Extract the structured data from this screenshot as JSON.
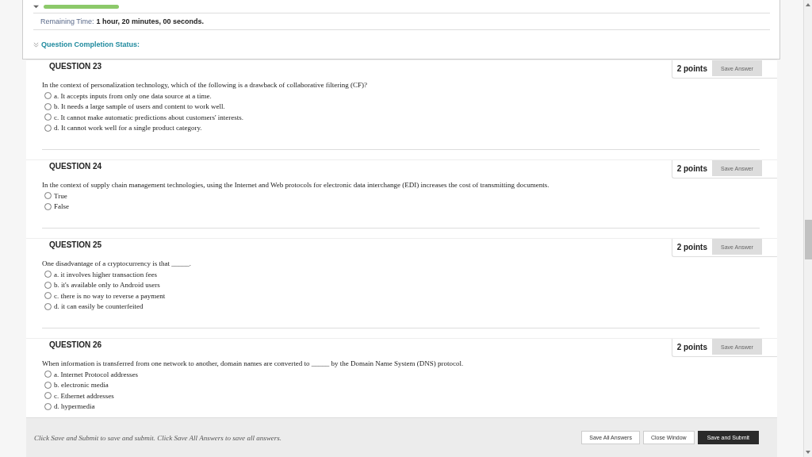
{
  "timer": {
    "level": 0.11,
    "label": "Remaining Time:",
    "value": "1 hour, 20 minutes, 00 seconds."
  },
  "completion_status": {
    "label": "Question Completion Status:",
    "expanded": false
  },
  "questions": [
    {
      "title": "QUESTION 23",
      "points": "2 points",
      "save_label": "Save Answer",
      "prompt": "In the context of personalization technology, which of the following is a drawback of collaborative filtering (CF)?",
      "options": [
        {
          "label": "a. It accepts inputs from only one data source at a time.",
          "selected": false
        },
        {
          "label": "b. It needs a large sample of users and content to work well.",
          "selected": false
        },
        {
          "label": "c. It cannot make automatic predictions about customers' interests.",
          "selected": false
        },
        {
          "label": "d. It cannot work well for a single product category.",
          "selected": false
        }
      ]
    },
    {
      "title": "QUESTION 24",
      "points": "2 points",
      "save_label": "Save Answer",
      "prompt": "In the context of supply chain management technologies, using the Internet and Web protocols for electronic data interchange (EDI) increases the cost of transmitting documents.",
      "options": [
        {
          "label": "True",
          "selected": false
        },
        {
          "label": "False",
          "selected": false
        }
      ]
    },
    {
      "title": "QUESTION 25",
      "points": "2 points",
      "save_label": "Save Answer",
      "prompt": "One disadvantage of a cryptocurrency is that _____.",
      "options": [
        {
          "label": "a. it involves higher transaction fees",
          "selected": false
        },
        {
          "label": "b. it's available only to Android users",
          "selected": false
        },
        {
          "label": "c. there is no way to reverse a payment",
          "selected": false
        },
        {
          "label": "d. it can easily be counterfeited",
          "selected": false
        }
      ]
    },
    {
      "title": "QUESTION 26",
      "points": "2 points",
      "save_label": "Save Answer",
      "prompt": "When information is transferred from one network to another, domain names are converted to _____ by the Domain Name System (DNS) protocol.",
      "options": [
        {
          "label": "a. Internet Protocol addresses",
          "selected": false
        },
        {
          "label": "b. electronic media",
          "selected": false
        },
        {
          "label": "c. Ethernet addresses",
          "selected": false
        },
        {
          "label": "d. hypermedia",
          "selected": false
        }
      ]
    }
  ],
  "footer": {
    "hint": "Click Save and Submit to save and submit. Click Save All Answers to save all answers.",
    "buttons": [
      {
        "label": "Save All Answers",
        "kind": "secondary"
      },
      {
        "label": "Close Window",
        "kind": "secondary"
      },
      {
        "label": "Save and Submit",
        "kind": "primary"
      }
    ]
  }
}
